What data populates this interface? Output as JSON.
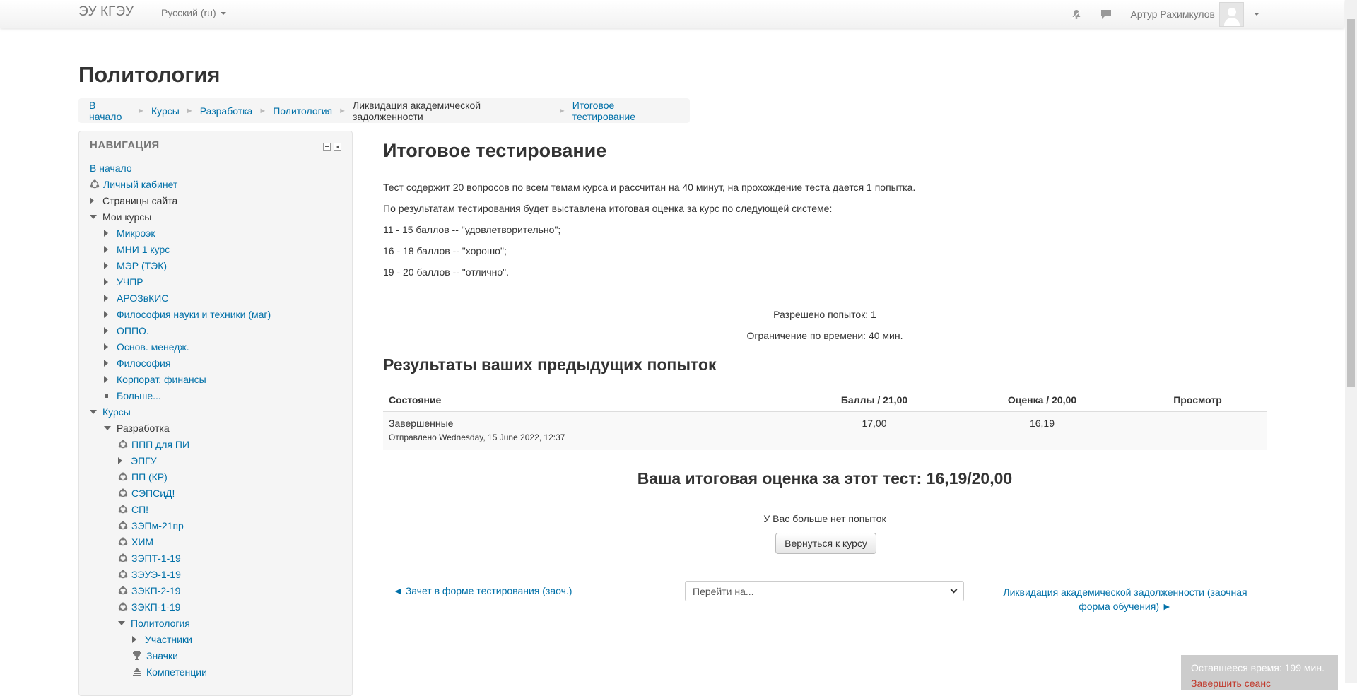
{
  "navbar": {
    "brand": "ЭУ КГЭУ",
    "language": "Русский (ru)",
    "username": "Артур Рахимкулов"
  },
  "page": {
    "title": "Политология"
  },
  "breadcrumb": [
    {
      "label": "В начало",
      "link": true
    },
    {
      "label": "Курсы",
      "link": true
    },
    {
      "label": "Разработка",
      "link": true
    },
    {
      "label": "Политология",
      "link": true
    },
    {
      "label": "Ликвидация академической задолженности",
      "link": false
    },
    {
      "label": "Итоговое тестирование",
      "link": true
    }
  ],
  "navigation": {
    "title": "НАВИГАЦИЯ",
    "items": [
      {
        "label": "В начало",
        "type": "link",
        "icon": "none"
      },
      {
        "label": "Личный кабинет",
        "type": "link",
        "icon": "course-icon"
      },
      {
        "label": "Страницы сайта",
        "type": "text",
        "icon": "expand-right"
      },
      {
        "label": "Мои курсы",
        "type": "text",
        "icon": "expand-down"
      },
      {
        "label": "Микроэк",
        "type": "link",
        "icon": "expand-right"
      },
      {
        "label": "МНИ 1 курс",
        "type": "link",
        "icon": "expand-right"
      },
      {
        "label": "МЭР (ТЭК)",
        "type": "link",
        "icon": "expand-right"
      },
      {
        "label": "УЧПР",
        "type": "link",
        "icon": "expand-right"
      },
      {
        "label": "АРОЗвКИС",
        "type": "link",
        "icon": "expand-right"
      },
      {
        "label": "Философия науки и техники (маг)",
        "type": "link",
        "icon": "expand-right"
      },
      {
        "label": "ОППО.",
        "type": "link",
        "icon": "expand-right"
      },
      {
        "label": "Основ. менедж.",
        "type": "link",
        "icon": "expand-right"
      },
      {
        "label": "Философия",
        "type": "link",
        "icon": "expand-right"
      },
      {
        "label": "Корпорат. финансы",
        "type": "link",
        "icon": "expand-right"
      },
      {
        "label": "Больше...",
        "type": "link",
        "icon": "bullet"
      },
      {
        "label": "Курсы",
        "type": "link",
        "icon": "expand-down"
      },
      {
        "label": "Разработка",
        "type": "text",
        "icon": "expand-down"
      },
      {
        "label": "ППП для ПИ",
        "type": "link",
        "icon": "course-icon"
      },
      {
        "label": "ЭПГУ",
        "type": "link",
        "icon": "expand-right"
      },
      {
        "label": "ПП (КР)",
        "type": "link",
        "icon": "course-icon"
      },
      {
        "label": "СЭПСиД!",
        "type": "link",
        "icon": "course-icon"
      },
      {
        "label": "СП!",
        "type": "link",
        "icon": "course-icon"
      },
      {
        "label": "ЗЭПм-21пр",
        "type": "link",
        "icon": "course-icon"
      },
      {
        "label": "ХИМ",
        "type": "link",
        "icon": "course-icon"
      },
      {
        "label": "ЗЭПТ-1-19",
        "type": "link",
        "icon": "course-icon"
      },
      {
        "label": "ЗЭУЭ-1-19",
        "type": "link",
        "icon": "course-icon"
      },
      {
        "label": "ЗЭКП-2-19",
        "type": "link",
        "icon": "course-icon"
      },
      {
        "label": "ЗЭКП-1-19",
        "type": "link",
        "icon": "course-icon"
      },
      {
        "label": "Политология",
        "type": "link",
        "icon": "expand-down"
      },
      {
        "label": "Участники",
        "type": "link",
        "icon": "expand-right"
      },
      {
        "label": "Значки",
        "type": "link",
        "icon": "trophy-icon"
      },
      {
        "label": "Компетенции",
        "type": "link",
        "icon": "competency-icon"
      }
    ]
  },
  "quiz": {
    "title": "Итоговое тестирование",
    "intro": [
      "Тест содержит 20 вопросов по всем темам курса и рассчитан на 40 минут, на прохождение теста дается 1 попытка.",
      "По результатам тестирования будет выставлена итоговая оценка за курс по следующей системе:",
      "11 - 15 баллов -- \"удовлетворительно\";",
      "16 - 18 баллов -- \"хорошо\";",
      "19 - 20 баллов -- \"отлично\"."
    ],
    "attempts_allowed": "Разрешено попыток: 1",
    "time_limit": "Ограничение по времени: 40 мин.",
    "results_title": "Результаты ваших предыдущих попыток",
    "table": {
      "headers": [
        "Состояние",
        "Баллы / 21,00",
        "Оценка / 20,00",
        "Просмотр"
      ],
      "rows": [
        {
          "state": "Завершенные",
          "submitted": "Отправлено Wednesday, 15 June 2022, 12:37",
          "marks": "17,00",
          "grade": "16,19",
          "review": ""
        }
      ]
    },
    "final_grade": "Ваша итоговая оценка за этот тест: 16,19/20,00",
    "no_more_attempts": "У Вас больше нет попыток",
    "back_button": "Вернуться к курсу",
    "prev_activity": "◄ Зачет в форме тестирования (заоч.)",
    "jump_to": "Перейти на...",
    "next_activity": "Ликвидация академической задолженности (заочная форма обучения) ►"
  },
  "timer": {
    "remaining": "Оставшееся время: 199 мин.",
    "finish": "Завершить сеанс"
  },
  "colors": {
    "link": "#0070a8",
    "text": "#333333",
    "muted": "#777777"
  }
}
